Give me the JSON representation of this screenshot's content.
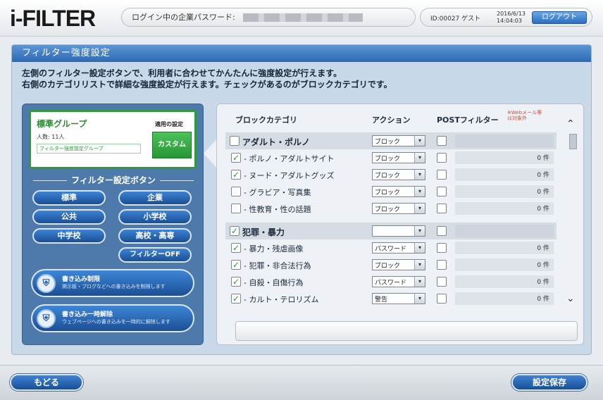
{
  "header": {
    "logo": "i-FILTER",
    "login_label": "ログイン中の企業パスワード:",
    "user_id": "ID:00027 ゲスト",
    "date": "2016/6/13",
    "time": "14:04:03",
    "logout_label": "ログアウト"
  },
  "main": {
    "title": "フィルター強度設定",
    "desc_line1": "左側のフィルター設定ボタンで、利用者に合わせてかんたんに強度設定が行えます。",
    "desc_line2": "右側のカテゴリリストで詳細な強度設定が行えます。チェックがあるのがブロックカテゴリです。"
  },
  "left": {
    "group_title": "標準グループ",
    "apply_label": "適用の設定",
    "group_desc": "人数: 11人",
    "group_link": "フィルター強度設定グループ",
    "custom_label": "カスタム",
    "fb_heading": "フィルター設定ボタン",
    "buttons": {
      "standard": "標準",
      "enterprise": "企業",
      "public": "公共",
      "elementary": "小学校",
      "junior_high": "中学校",
      "high_school": "高校・高専",
      "filter_off": "フィルターOFF"
    },
    "big1_title": "書き込み制限",
    "big1_desc": "掲示板・ブログなどへの書き込みを制限します",
    "big2_title": "書き込み一時解除",
    "big2_desc": "ウェブページへの書き込みを一時的に解除します"
  },
  "right": {
    "col_category": "ブロックカテゴリ",
    "col_action": "アクション",
    "col_post": "POSTフィルター",
    "post_note": "※Webメール等は対象外",
    "rows": [
      {
        "type": "cat",
        "checked": false,
        "label": "アダルト・ポルノ",
        "action": "ブロック",
        "post": false,
        "count": ""
      },
      {
        "type": "sub",
        "checked": true,
        "label": "- ポルノ・アダルトサイト",
        "action": "ブロック",
        "post": false,
        "count": "0 件"
      },
      {
        "type": "sub",
        "checked": true,
        "label": "- ヌード・アダルトグッズ",
        "action": "ブロック",
        "post": false,
        "count": "0 件"
      },
      {
        "type": "sub",
        "checked": false,
        "label": "- グラビア・写真集",
        "action": "ブロック",
        "post": false,
        "count": "0 件"
      },
      {
        "type": "sub",
        "checked": false,
        "label": "- 性教育・性の話題",
        "action": "ブロック",
        "post": false,
        "count": "0 件"
      },
      {
        "type": "cat",
        "checked": true,
        "label": "犯罪・暴力",
        "action": "",
        "post": false,
        "count": ""
      },
      {
        "type": "sub",
        "checked": true,
        "label": "- 暴力・残虐画像",
        "action": "パスワード",
        "post": false,
        "count": "0 件"
      },
      {
        "type": "sub",
        "checked": true,
        "label": "- 犯罪・非合法行為",
        "action": "ブロック",
        "post": false,
        "count": "0 件"
      },
      {
        "type": "sub",
        "checked": true,
        "label": "- 自殺・自傷行為",
        "action": "パスワード",
        "post": false,
        "count": "0 件"
      },
      {
        "type": "sub",
        "checked": true,
        "label": "- カルト・テロリズム",
        "action": "警告",
        "post": false,
        "count": "0 件"
      }
    ]
  },
  "footer": {
    "back_label": "もどる",
    "save_label": "設定保存"
  },
  "icons": {
    "scroll_up": "⌃",
    "scroll_down": "⌄",
    "select_arrow": "▾",
    "check": "✓"
  }
}
